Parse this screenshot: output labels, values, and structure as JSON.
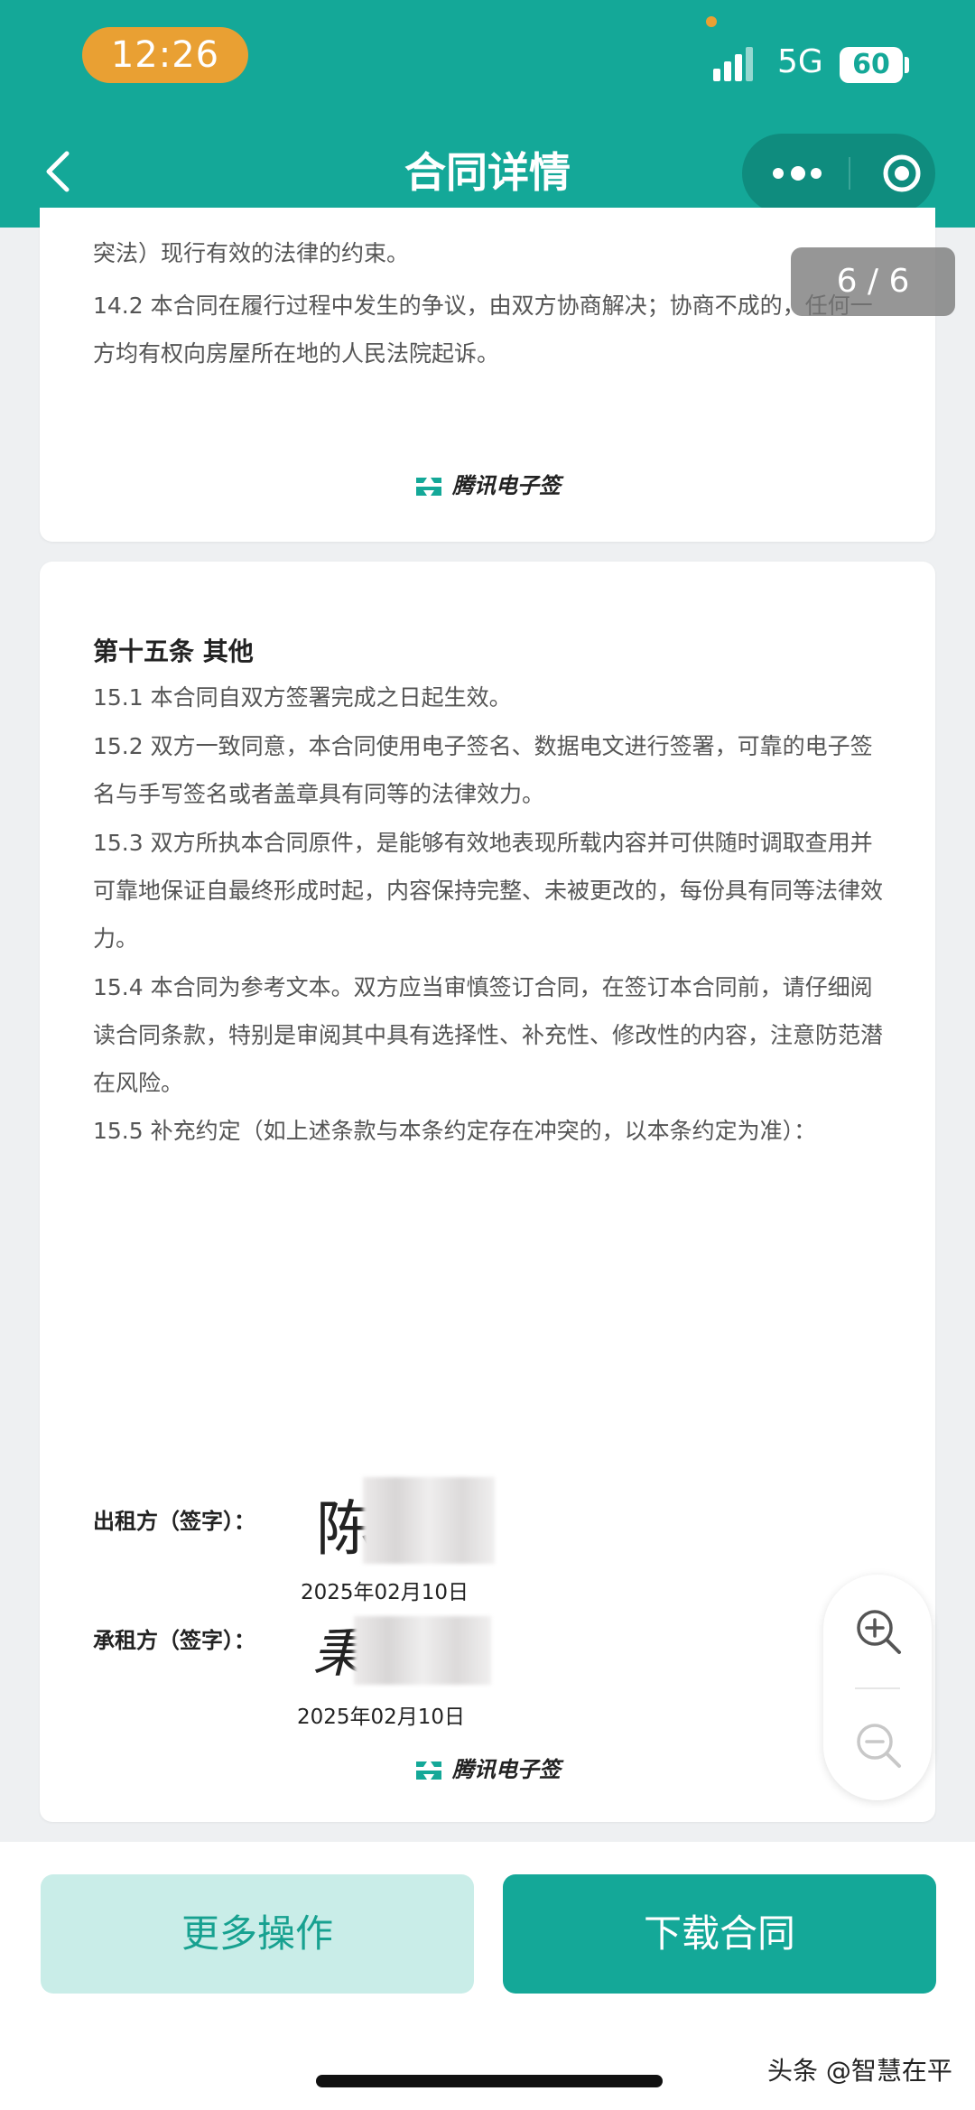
{
  "status_bar": {
    "time": "12:26",
    "network": "5G",
    "battery": "60"
  },
  "nav": {
    "title": "合同详情"
  },
  "viewer": {
    "page_counter": "6 / 6"
  },
  "page_5_tail": {
    "line_1": "突法）现行有效的法律的约束。",
    "clause_14_2": "14.2 本合同在履行过程中发生的争议，由双方协商解决；协商不成的，任何一方均有权向房屋所在地的人民法院起诉。",
    "brand": "腾讯电子签"
  },
  "page_6": {
    "section_title": "第十五条 其他",
    "clauses": [
      "15.1 本合同自双方签署完成之日起生效。",
      "15.2 双方一致同意，本合同使用电子签名、数据电文进行签署，可靠的电子签名与手写签名或者盖章具有同等的法律效力。",
      "15.3 双方所执本合同原件，是能够有效地表现所载内容并可供随时调取查用并可靠地保证自最终形成时起，内容保持完整、未被更改的，每份具有同等法律效力。",
      "15.4 本合同为参考文本。双方应当审慎签订合同，在签订本合同前，请仔细阅读合同条款，特别是审阅其中具有选择性、补充性、修改性的内容，注意防范潜在风险。",
      "15.5 补充约定（如上述条款与本条约定存在冲突的，以本条约定为准）："
    ],
    "landlord_label": "出租方（签字）：",
    "landlord_signature": "陈",
    "landlord_date": "2025年02月10日",
    "tenant_label": "承租方（签字）：",
    "tenant_signature": "秉",
    "tenant_date": "2025年02月10日",
    "brand": "腾讯电子签"
  },
  "actions": {
    "more": "更多操作",
    "download": "下载合同"
  },
  "watermark": "头条 @智慧在平",
  "colors": {
    "primary": "#14a898",
    "primary_light": "#c9ede8",
    "time_pill": "#e9a033"
  },
  "icons": [
    "back-icon",
    "more-dots-icon",
    "target-icon",
    "zoom-in-icon",
    "zoom-out-icon",
    "tencent-esign-logo"
  ]
}
